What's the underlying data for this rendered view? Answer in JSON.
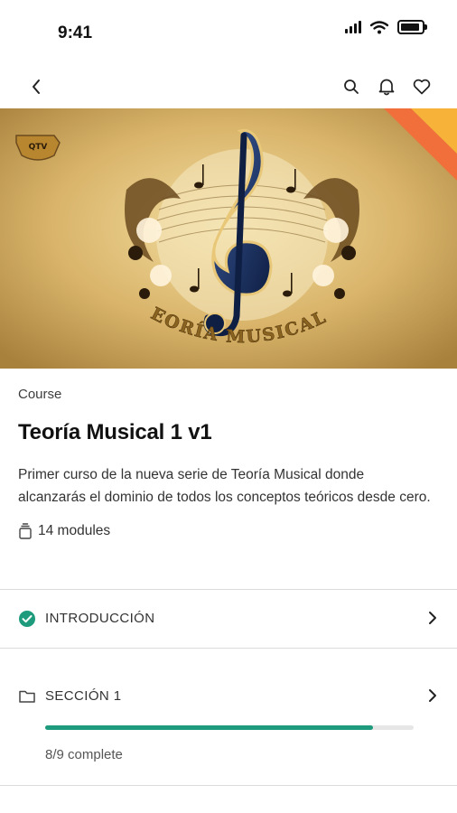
{
  "status_bar": {
    "time": "9:41",
    "icons": [
      "signal-icon",
      "wifi-icon",
      "battery-icon"
    ]
  },
  "nav": {
    "icons": [
      "back-chevron-icon",
      "search-icon",
      "bell-icon",
      "heart-icon"
    ]
  },
  "banner": {
    "badge_text": "QTV",
    "title_text": "TEORÍA MUSICAL 1"
  },
  "course": {
    "type": "Course",
    "title": "Teoría Musical 1 v1",
    "description": "Primer curso de la nueva serie de Teoría Musical donde alcanzarás el dominio de todos los conceptos teóricos desde cero.",
    "modules": "14 modules"
  },
  "sections": [
    {
      "label": "INTRODUCCIÓN",
      "icon": "check-circle-icon",
      "status_color": "#1d9b7c"
    },
    {
      "label": "SECCIÓN 1",
      "icon": "folder-icon",
      "progress": 0.889,
      "progress_text": "8/9 complete",
      "progress_color": "#1d9b7c"
    }
  ]
}
